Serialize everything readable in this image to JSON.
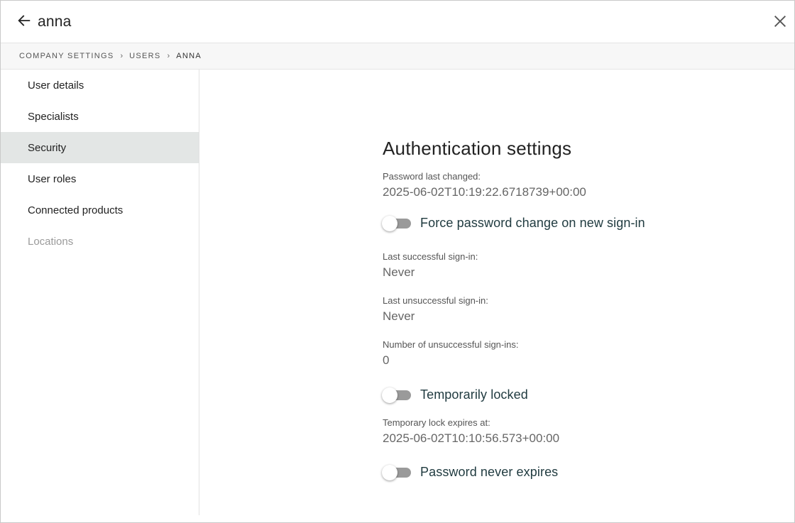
{
  "header": {
    "title": "anna",
    "back_icon": "arrow-left-icon",
    "close_icon": "close-icon"
  },
  "breadcrumb": {
    "items": [
      "COMPANY SETTINGS",
      "USERS",
      "ANNA"
    ],
    "separator_icon": "chevron-right-icon"
  },
  "sidebar": {
    "items": [
      {
        "label": "User details",
        "state": "normal"
      },
      {
        "label": "Specialists",
        "state": "normal"
      },
      {
        "label": "Security",
        "state": "active"
      },
      {
        "label": "User roles",
        "state": "normal"
      },
      {
        "label": "Connected products",
        "state": "normal"
      },
      {
        "label": "Locations",
        "state": "disabled"
      }
    ]
  },
  "main": {
    "title": "Authentication settings",
    "password_last_changed": {
      "label": "Password last changed:",
      "value": "2025-06-02T10:19:22.6718739+00:00"
    },
    "force_password_change": {
      "label": "Force password change on new sign-in",
      "checked": false
    },
    "last_successful_signin": {
      "label": "Last successful sign-in:",
      "value": "Never"
    },
    "last_unsuccessful_signin": {
      "label": "Last unsuccessful sign-in:",
      "value": "Never"
    },
    "unsuccessful_signins": {
      "label": "Number of unsuccessful sign-ins:",
      "value": "0"
    },
    "temporarily_locked": {
      "label": "Temporarily locked",
      "checked": false
    },
    "lock_expires": {
      "label": "Temporary lock expires at:",
      "value": "2025-06-02T10:10:56.573+00:00"
    },
    "password_never_expires": {
      "label": "Password never expires",
      "checked": false
    }
  },
  "colors": {
    "active_nav_bg": "#e3e6e5",
    "toggle_track_off": "#9a9a9a",
    "toggle_label": "#1f3a3f"
  }
}
